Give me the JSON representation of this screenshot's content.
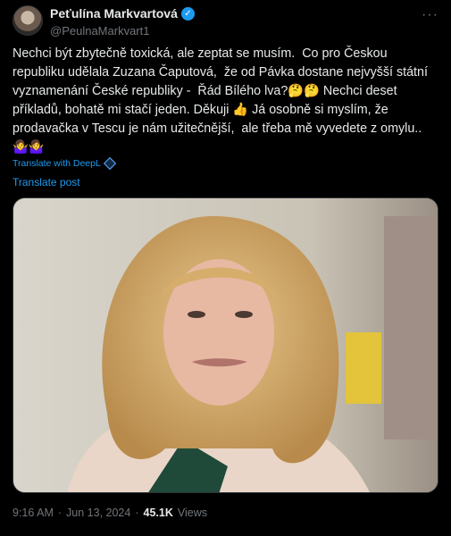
{
  "header": {
    "display_name": "Peťulína Markvartová",
    "handle": "@PeulnaMarkvart1",
    "verified_icon": "verified-badge-icon",
    "more_icon": "more-options-icon"
  },
  "tweet": {
    "text": "Nechci být zbytečně toxická, ale zeptat se musím.  Co pro Českou republiku udělala Zuzana Čaputová,  že od Pávka dostane nejvyšší státní vyznamenání České republiky -  Řád Bílého lva?🤔🤔 Nechci deset příkladů, bohatě mi stačí jeden. Děkuji 👍 Já osobně si myslím, že prodavačka v Tescu je nám užitečnější,  ale třeba mě vyvedete z omylu.. 🤷‍♀️🤷‍♀️"
  },
  "translate": {
    "deepl_label": "Translate with DeepL",
    "post_label": "Translate post"
  },
  "meta": {
    "time": "9:16 AM",
    "separator": "·",
    "date": "Jun 13, 2024",
    "views_count": "45.1K",
    "views_label": "Views"
  },
  "colors": {
    "background": "#000000",
    "text": "#e7e9ea",
    "muted": "#71767b",
    "link": "#1d9bf0"
  }
}
